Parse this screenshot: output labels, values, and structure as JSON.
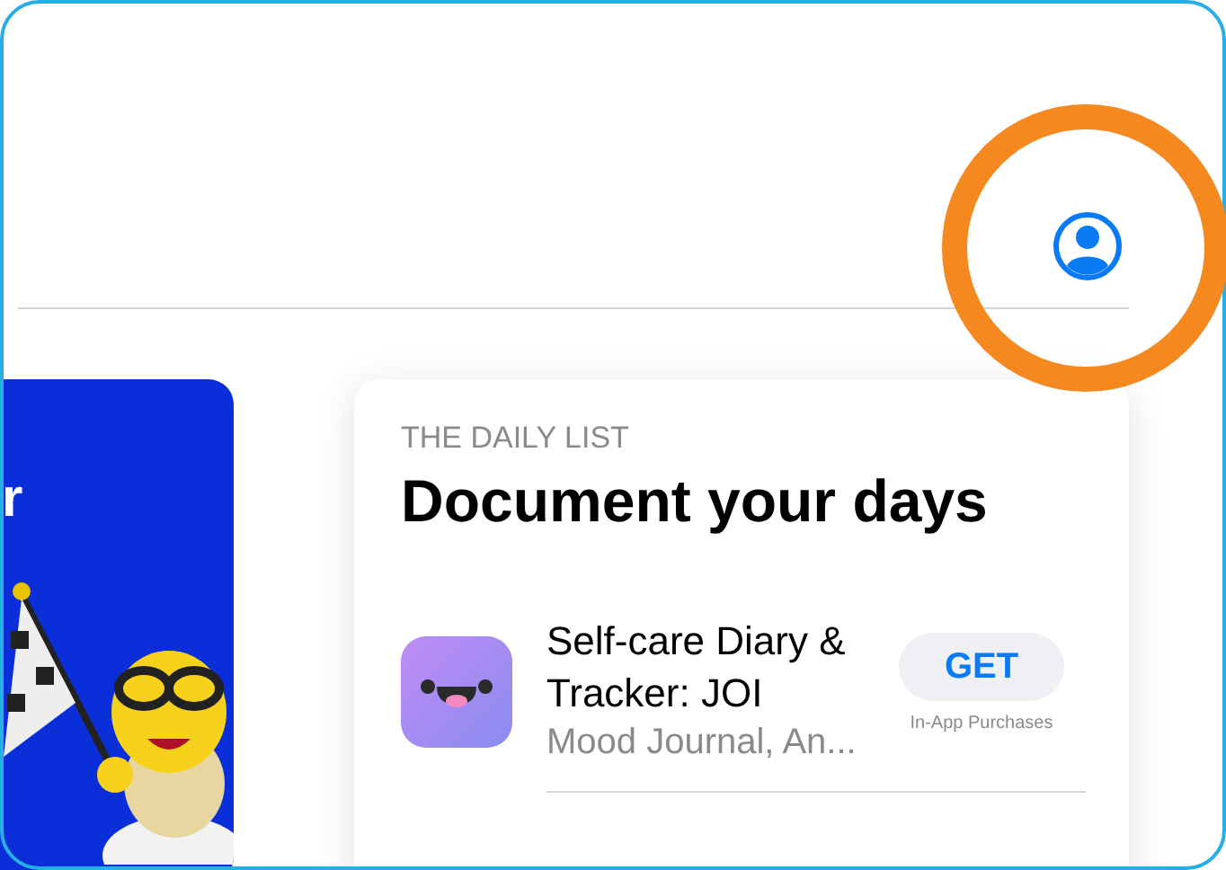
{
  "featured_card": {
    "title_fragment": "r"
  },
  "daily_list": {
    "eyebrow": "THE DAILY LIST",
    "title": "Document your days",
    "apps": [
      {
        "name": "Self-care Diary & Tracker: JOI",
        "subtitle": "Mood Journal, An...",
        "button": "GET",
        "note": "In-App Purchases"
      }
    ]
  }
}
